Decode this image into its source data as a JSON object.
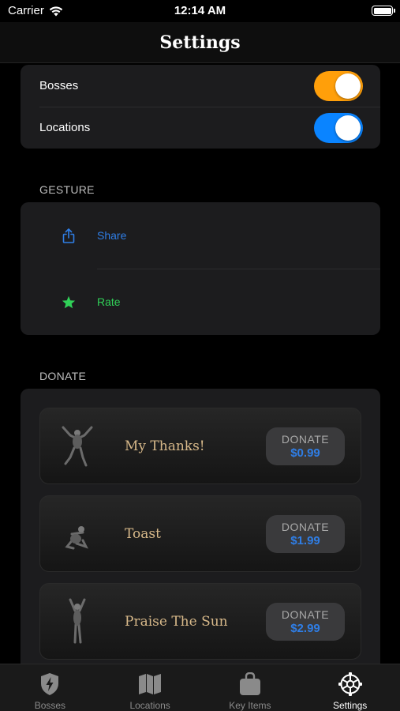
{
  "status_bar": {
    "carrier": "Carrier",
    "time": "12:14 AM"
  },
  "nav": {
    "title": "Settings"
  },
  "toggles": [
    {
      "label": "Bosses",
      "on": true,
      "color": "#ff9f0a"
    },
    {
      "label": "Locations",
      "on": true,
      "color": "#0a84ff"
    }
  ],
  "gesture": {
    "header": "GESTURE",
    "items": [
      {
        "label": "Share",
        "icon": "share-icon",
        "color": "#2f7ee6"
      },
      {
        "label": "Rate",
        "icon": "star-icon",
        "color": "#30d158"
      }
    ]
  },
  "donate": {
    "header": "DONATE",
    "items": [
      {
        "name": "My Thanks!",
        "button_label": "DONATE",
        "price": "$0.99"
      },
      {
        "name": "Toast",
        "button_label": "DONATE",
        "price": "$1.99"
      },
      {
        "name": "Praise The Sun",
        "button_label": "DONATE",
        "price": "$2.99"
      }
    ]
  },
  "tabs": [
    {
      "label": "Bosses",
      "icon": "shield-bolt-icon",
      "active": false
    },
    {
      "label": "Locations",
      "icon": "map-icon",
      "active": false
    },
    {
      "label": "Key Items",
      "icon": "bag-icon",
      "active": false
    },
    {
      "label": "Settings",
      "icon": "gear-icon",
      "active": true
    }
  ]
}
